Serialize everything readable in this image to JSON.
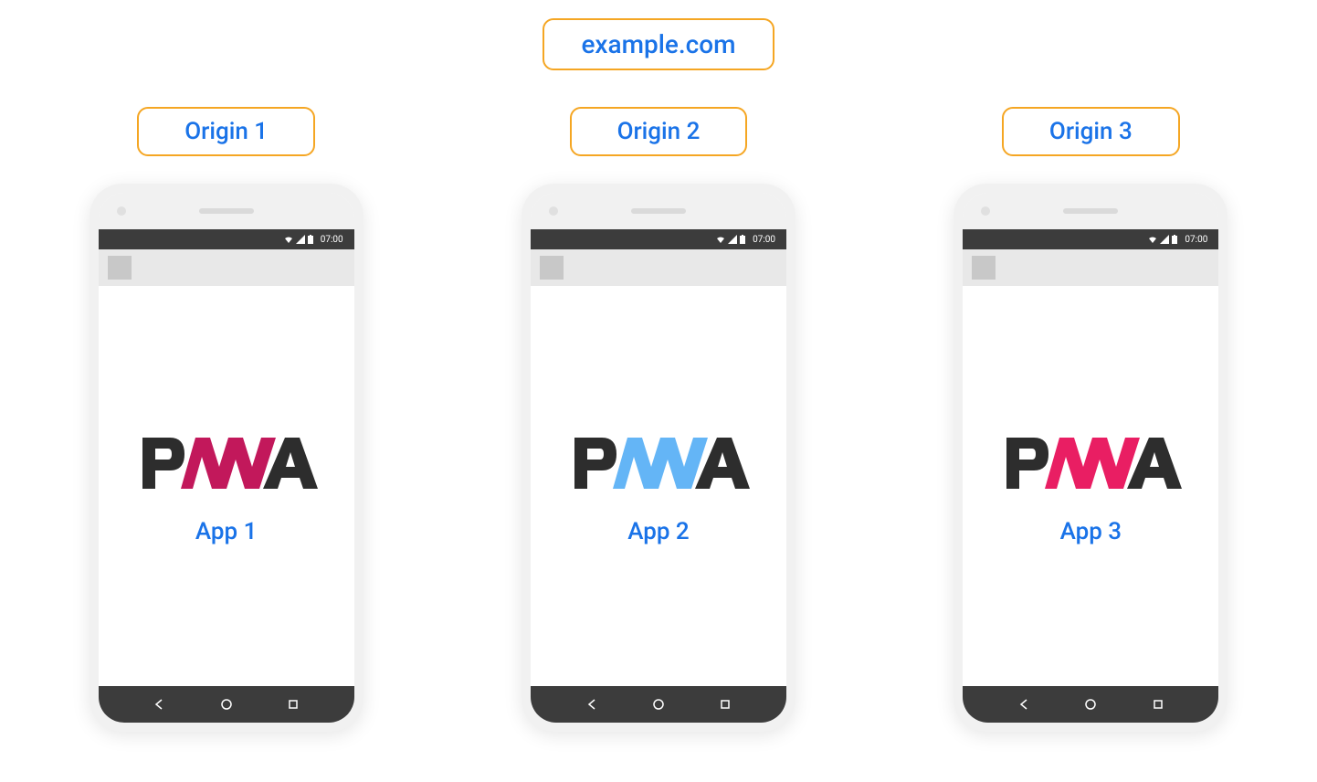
{
  "domain": "example.com",
  "status_time": "07:00",
  "phones": [
    {
      "origin_label": "Origin 1",
      "app_name": "App 1",
      "w_color": "#c2185b"
    },
    {
      "origin_label": "Origin 2",
      "app_name": "App 2",
      "w_color": "#64b5f6"
    },
    {
      "origin_label": "Origin 3",
      "app_name": "App 3",
      "w_color": "#e91e63"
    }
  ]
}
